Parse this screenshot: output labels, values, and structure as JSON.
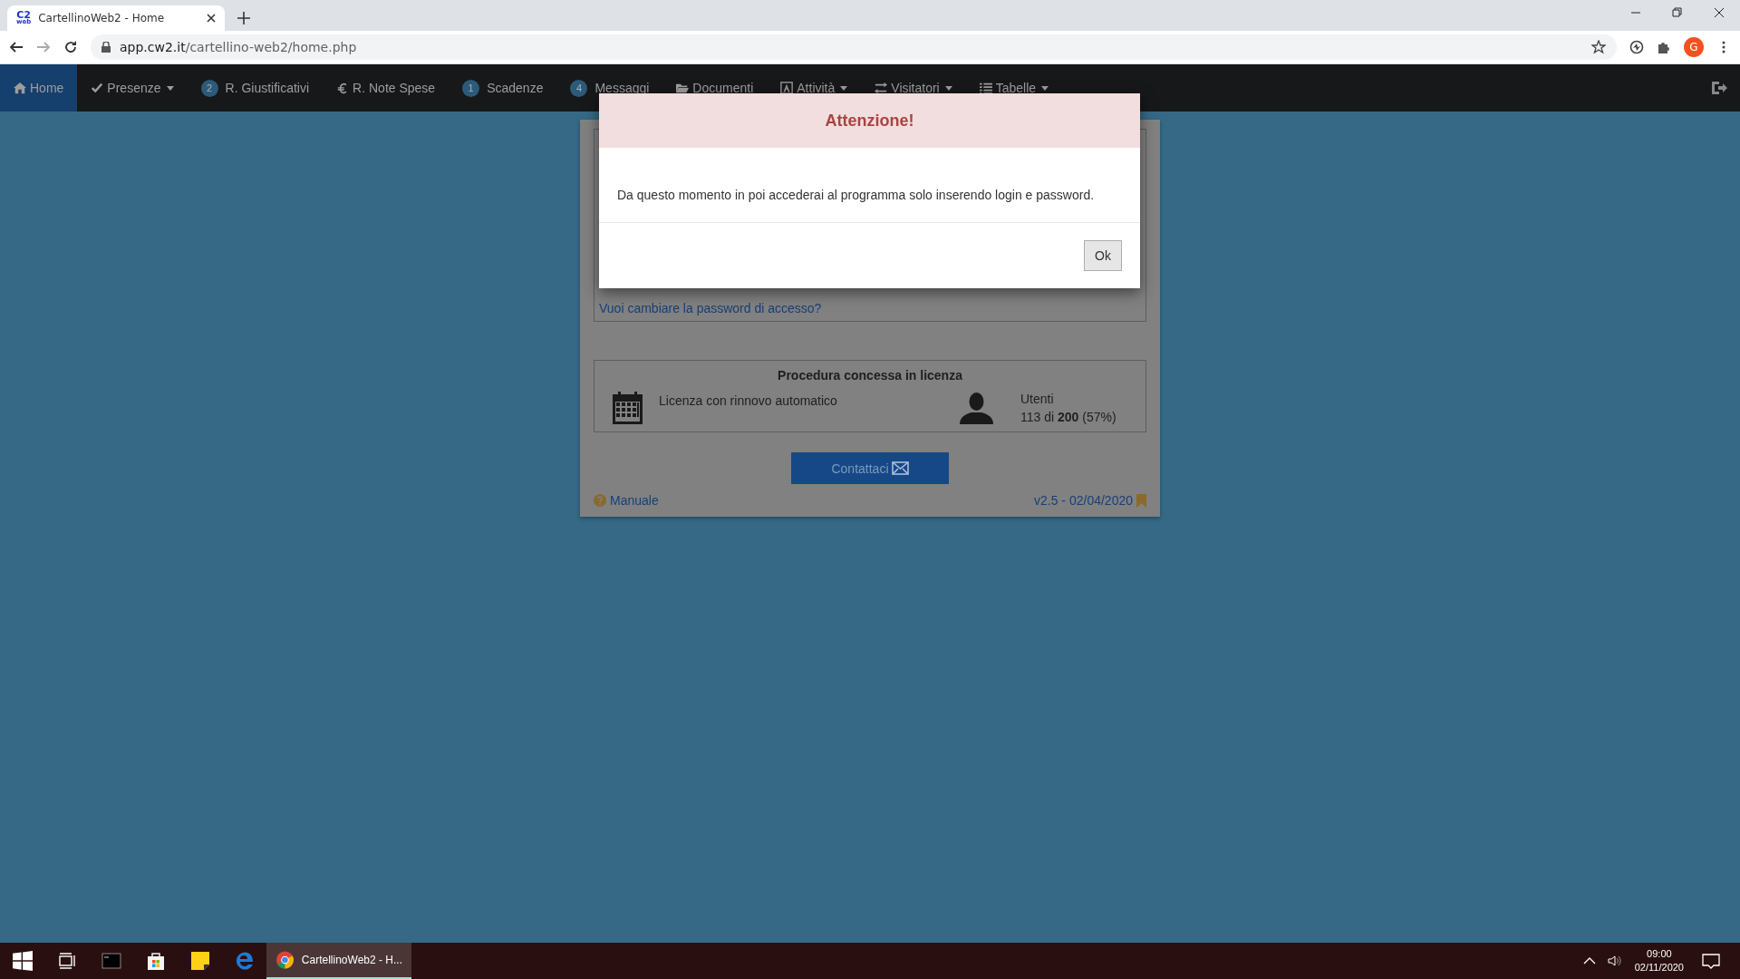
{
  "browser": {
    "tab_title": "CartellinoWeb2 - Home",
    "favicon_text": "C2",
    "favicon_sub": "web",
    "url_host": "app.cw2.it",
    "url_path": "/cartellino-web2/home.php",
    "profile": "G"
  },
  "navbar": {
    "items": [
      {
        "label": "Home",
        "kind": "home",
        "selected": true,
        "caret": false
      },
      {
        "label": "Presenze",
        "kind": "check",
        "selected": false,
        "caret": true
      },
      {
        "label": "R. Giustificativi",
        "kind": "badge",
        "badge": "2",
        "selected": false,
        "caret": false
      },
      {
        "label": "R. Note Spese",
        "kind": "euro",
        "selected": false,
        "caret": false
      },
      {
        "label": "Scadenze",
        "kind": "badge",
        "badge": "1",
        "selected": false,
        "caret": false
      },
      {
        "label": "Messaggi",
        "kind": "badge",
        "badge": "4",
        "selected": false,
        "caret": false
      },
      {
        "label": "Documenti",
        "kind": "folder",
        "selected": false,
        "caret": false
      },
      {
        "label": "Attività",
        "kind": "font",
        "selected": false,
        "caret": true
      },
      {
        "label": "Visitatori",
        "kind": "exchange",
        "selected": false,
        "caret": true
      },
      {
        "label": "Tabelle",
        "kind": "list",
        "selected": false,
        "caret": true
      }
    ]
  },
  "card": {
    "password_link": "Vuoi cambiare la password di accesso?",
    "license_title": "Procedura concessa in licenza",
    "license_text": "Licenza con rinnovo automatico",
    "users_label": "Utenti",
    "users_value": "113 di **200** (57%)",
    "contact_button": "Contattaci",
    "manual_link": "Manuale",
    "version": "v2.5 - 02/04/2020"
  },
  "modal": {
    "title": "Attenzione!",
    "message": "Da questo momento in poi accederai al programma solo inserendo login e password.",
    "ok_button": "Ok"
  },
  "taskbar": {
    "app_label": "CartellinoWeb2 - H...",
    "time": "09:00",
    "date": "02/11/2020"
  }
}
